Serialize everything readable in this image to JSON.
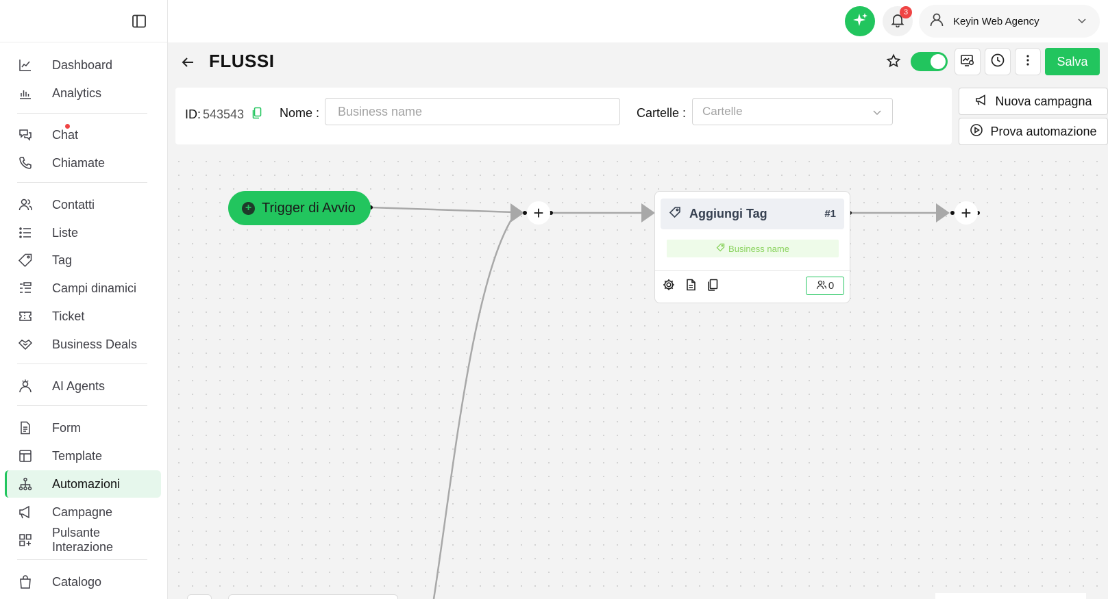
{
  "sidebar": {
    "items": [
      {
        "label": "Dashboard",
        "icon": "chart-line-icon"
      },
      {
        "label": "Analytics",
        "icon": "bar-chart-icon"
      },
      {
        "label": "Chat",
        "icon": "chat-bubbles-icon",
        "has_notification_dot": true
      },
      {
        "label": "Chiamate",
        "icon": "phone-icon"
      },
      {
        "label": "Contatti",
        "icon": "users-icon"
      },
      {
        "label": "Liste",
        "icon": "list-icon"
      },
      {
        "label": "Tag",
        "icon": "tag-icon"
      },
      {
        "label": "Campi dinamici",
        "icon": "dynamic-fields-icon"
      },
      {
        "label": "Ticket",
        "icon": "ticket-icon"
      },
      {
        "label": "Business Deals",
        "icon": "handshake-icon"
      },
      {
        "label": "AI Agents",
        "icon": "ai-agent-icon"
      },
      {
        "label": "Form",
        "icon": "form-icon"
      },
      {
        "label": "Template",
        "icon": "template-icon"
      },
      {
        "label": "Automazioni",
        "icon": "automation-icon",
        "active": true
      },
      {
        "label": "Campagne",
        "icon": "megaphone-icon"
      },
      {
        "label": "Pulsante Interazione",
        "icon": "grid-plus-icon"
      },
      {
        "label": "Catalogo",
        "icon": "shopping-bag-icon"
      }
    ]
  },
  "header": {
    "notification_count": "3",
    "account_name": "Keyin Web Agency"
  },
  "page": {
    "title": "FLUSSI",
    "active_toggle": true,
    "save_label": "Salva"
  },
  "info": {
    "id_label": "ID:",
    "id_value": "543543",
    "name_label": "Nome :",
    "name_placeholder": "Business name",
    "name_value": "",
    "folders_label": "Cartelle :",
    "folders_placeholder": "Cartelle"
  },
  "actions": {
    "new_campaign": "Nuova campagna",
    "test_automation": "Prova automazione"
  },
  "flow": {
    "trigger_label": "Trigger di Avvio",
    "node": {
      "title": "Aggiungi Tag",
      "number": "#1",
      "tag_value": "Business name",
      "contacts_count": "0"
    }
  },
  "colors": {
    "accent": "#22c55e",
    "badge": "#ef4444",
    "active_nav_bg": "#e6f7ec"
  }
}
